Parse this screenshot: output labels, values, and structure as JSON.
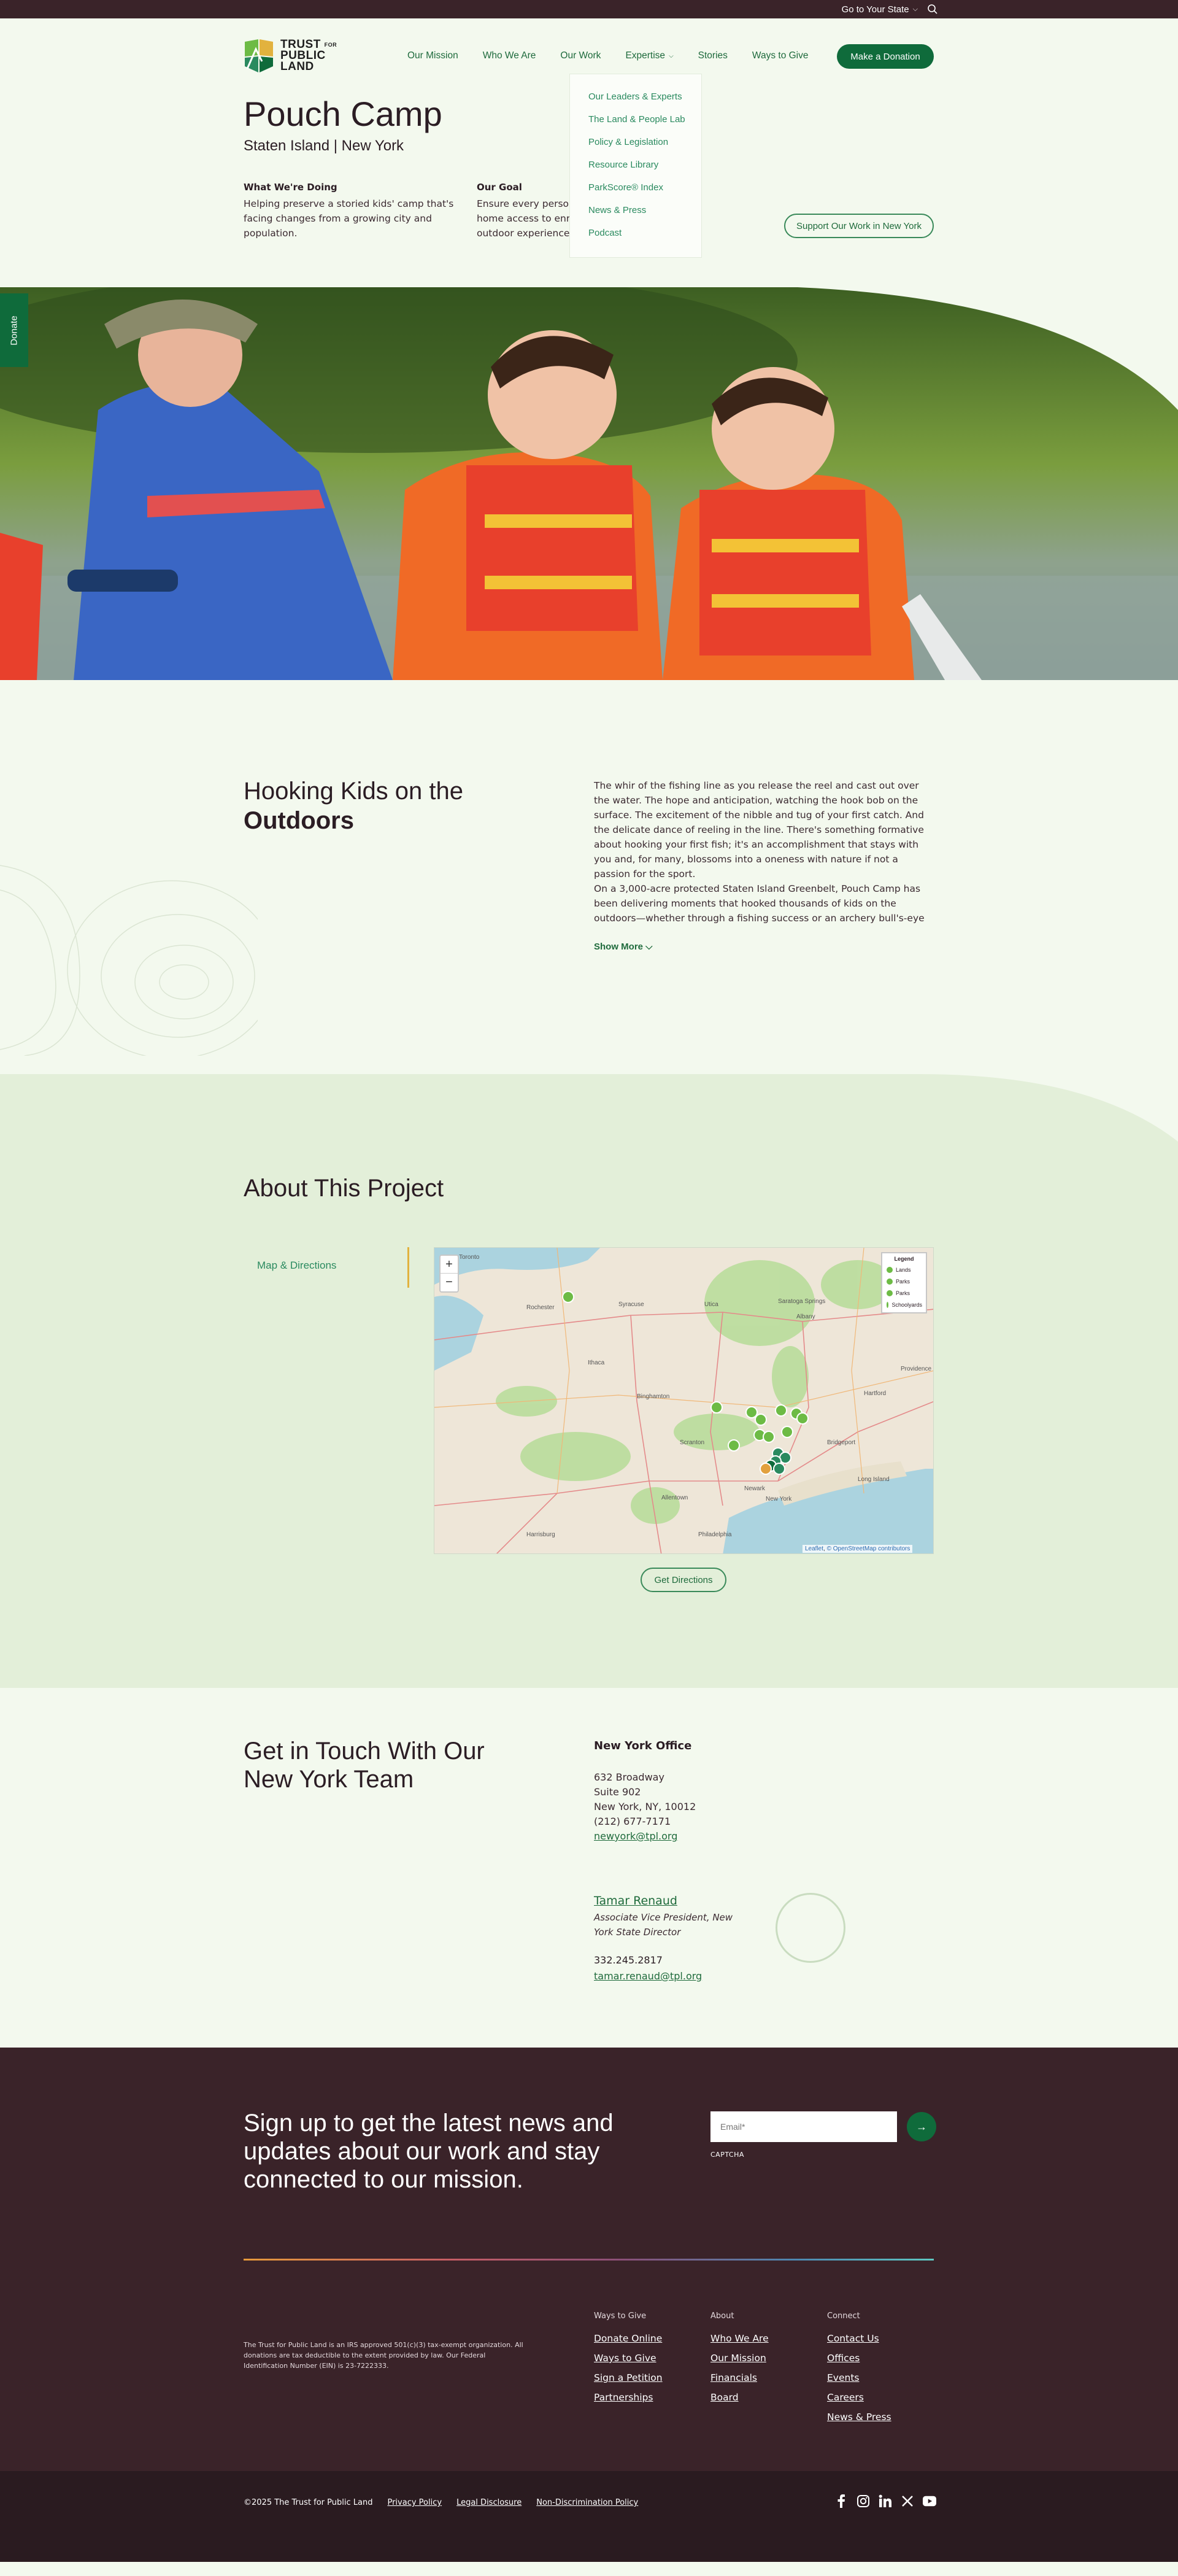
{
  "utility": {
    "state_label": "Go to Your State",
    "chevron": "⌵"
  },
  "header": {
    "logo_lines": [
      "TRUST",
      "PUBLIC",
      "LAND"
    ],
    "logo_for": "FOR",
    "nav": [
      "Our Mission",
      "Who We Are",
      "Our Work",
      "Expertise",
      "Stories",
      "Ways to Give"
    ],
    "donate_label": "Make a Donation"
  },
  "dropdown": [
    "Our Leaders & Experts",
    "The Land & People Lab",
    "Policy & Legislation",
    "Resource Library",
    "ParkScore® Index",
    "News & Press",
    "Podcast"
  ],
  "hero": {
    "title": "Pouch Camp",
    "subtitle": "Staten Island | New York",
    "doing_heading": "What We're Doing",
    "doing_text": "Helping preserve a storied kids' camp that's facing changes from a growing city and population.",
    "goal_heading": "Our Goal",
    "goal_text": "Ensure every person in New York has close-to-home access to enriching and meaningful outdoor experiences.",
    "support_label": "Support Our Work in New York",
    "donate_tab": "Donate"
  },
  "intro": {
    "heading_light": "Hooking Kids on the",
    "heading_bold": "Outdoors",
    "p1": "The whir of the fishing line as you release the reel and cast out over the water. The hope and anticipation, watching the hook bob on the surface. The excitement of the nibble and tug of your first catch. And the delicate dance of reeling in the line. There's something formative about hooking your first fish; it's an accomplishment that stays with you and, for many, blossoms into a oneness with nature if not a passion for the sport.",
    "p2": "On a 3,000-acre protected Staten Island Greenbelt, Pouch Camp has been delivering moments that hooked thousands of kids on the outdoors—whether through a fishing success or an archery bull's-eye or a paddle across the lake",
    "show_more": "Show More ⌵"
  },
  "about": {
    "heading": "About This Project",
    "tab": "Map & Directions",
    "legend_title": "Legend",
    "legend_items": [
      "Lands",
      "Parks",
      "Parks",
      "Schoolyards"
    ],
    "attribution_leaflet": "Leaflet",
    "attribution_osm": "© OpenStreetMap contributors",
    "directions_label": "Get Directions",
    "place_labels": [
      "Toronto",
      "Rochester",
      "Syracuse",
      "Albany",
      "Binghamton",
      "Scranton",
      "Allentown",
      "Hartford",
      "Providence",
      "Bridgeport",
      "Long Island",
      "Newark",
      "New York",
      "Philadelphia",
      "Harrisburg",
      "Saratoga Springs",
      "Utica",
      "Ithaca"
    ]
  },
  "contact": {
    "heading": "Get in Touch With Our New York Team",
    "office_heading": "New York Office",
    "address": [
      "632 Broadway",
      "Suite 902",
      "New York, NY, 10012",
      "(212) 677-7171"
    ],
    "office_email": "newyork@tpl.org",
    "person_name": "Tamar Renaud",
    "person_title": "Associate Vice President, New York State Director",
    "person_phone": "332.245.2817",
    "person_email": "tamar.renaud@tpl.org"
  },
  "footer": {
    "signup_heading": "Sign up to get the latest news and updates about our work and stay connected to our mission.",
    "email_placeholder": "Email*",
    "submit_arrow": "→",
    "captcha": "CAPTCHA",
    "legal": "The Trust for Public Land is an IRS approved 501(c)(3) tax-exempt organization. All donations are tax deductible to the extent provided by law. Our Federal Identification Number (EIN) is 23-7222333.",
    "columns": [
      {
        "heading": "Ways to Give",
        "links": [
          "Donate Online",
          "Ways to Give",
          "Sign a Petition",
          "Partnerships"
        ]
      },
      {
        "heading": "About",
        "links": [
          "Who We Are",
          "Our Mission",
          "Financials",
          "Board"
        ]
      },
      {
        "heading": "Connect",
        "links": [
          "Contact Us",
          "Offices",
          "Events",
          "Careers",
          "News & Press"
        ]
      }
    ],
    "copyright": "©2025 The Trust for Public Land",
    "bottom_links": [
      "Privacy Policy",
      "Legal Disclosure",
      "Non-Discrimination Policy"
    ]
  },
  "colors": {
    "brand_green": "#0f6b3b",
    "dark_maroon": "#3a2329",
    "page_bg": "#f3f9ee",
    "accent_gold": "#e2b23e"
  }
}
